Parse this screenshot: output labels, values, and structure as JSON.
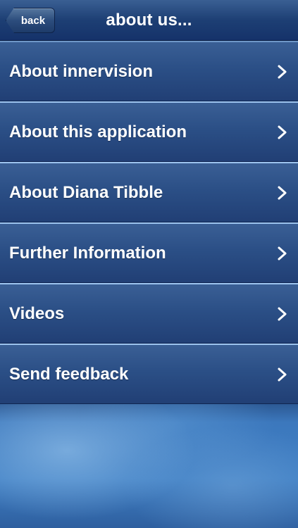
{
  "navbar": {
    "back_label": "back",
    "title": "about us..."
  },
  "menu": {
    "items": [
      {
        "label": "About innervision"
      },
      {
        "label": "About this application"
      },
      {
        "label": "About Diana Tibble"
      },
      {
        "label": "Further Information"
      },
      {
        "label": "Videos"
      },
      {
        "label": "Send feedback"
      }
    ]
  },
  "colors": {
    "navbar": "#1d3f74",
    "row": "#2b4f86",
    "row_highlight": "#9cc3ee",
    "text": "#ffffff"
  },
  "icons": {
    "row_chevron": "chevron-right-icon"
  }
}
